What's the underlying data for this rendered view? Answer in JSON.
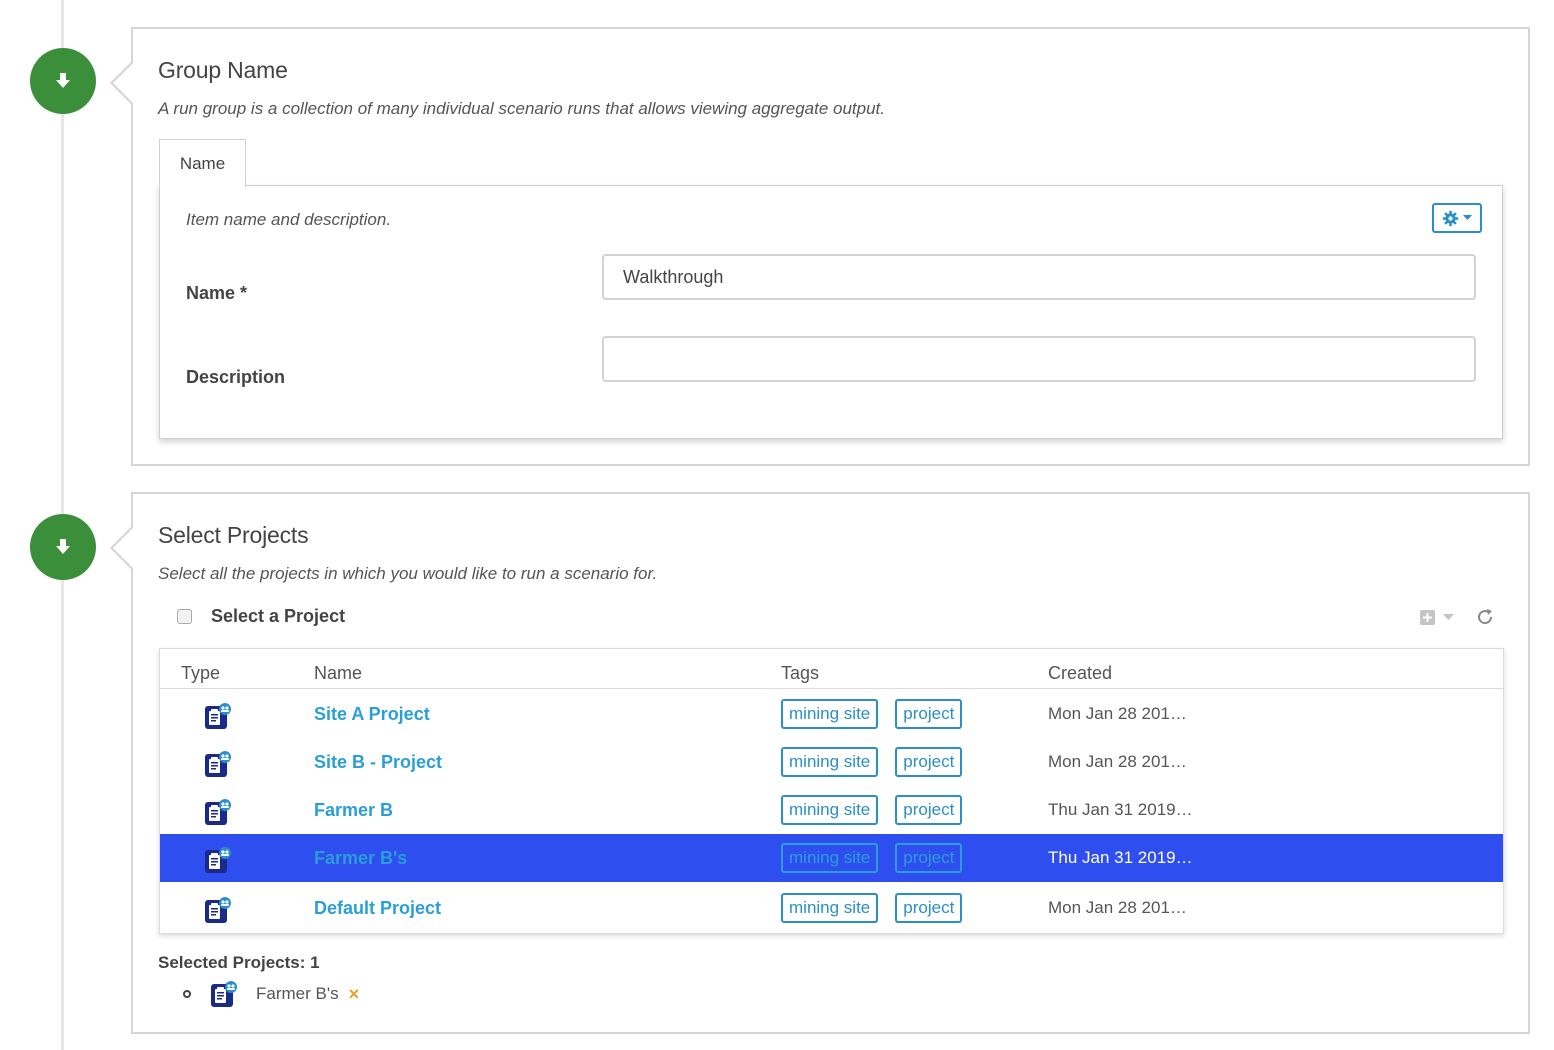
{
  "steps": [
    {
      "title": "Group Name",
      "description": "A run group is a collection of many individual scenario runs that allows viewing aggregate output.",
      "tabs": [
        {
          "label": "Name"
        }
      ],
      "tab_description": "Item name and description.",
      "fields": {
        "name": {
          "label": "Name *",
          "value": "Walkthrough"
        },
        "description": {
          "label": "Description",
          "value": ""
        }
      }
    },
    {
      "title": "Select Projects",
      "description": "Select all the projects in which you would like to run a scenario for.",
      "select_all_label": "Select a Project",
      "table": {
        "columns": [
          "Type",
          "Name",
          "Tags",
          "Created"
        ],
        "rows": [
          {
            "name": "Site A Project",
            "tags": [
              "mining site",
              "project"
            ],
            "created": "Mon Jan 28 201…",
            "selected": false
          },
          {
            "name": "Site B - Project",
            "tags": [
              "mining site",
              "project"
            ],
            "created": "Mon Jan 28 201…",
            "selected": false
          },
          {
            "name": "Farmer B",
            "tags": [
              "mining site",
              "project"
            ],
            "created": "Thu Jan 31 2019…",
            "selected": false
          },
          {
            "name": "Farmer B's",
            "tags": [
              "mining site",
              "project"
            ],
            "created": "Thu Jan 31 2019…",
            "selected": true
          },
          {
            "name": "Default Project",
            "tags": [
              "mining site",
              "project"
            ],
            "created": "Mon Jan 28 201…",
            "selected": false
          }
        ]
      },
      "selected_label": "Selected Projects: 1",
      "selected_items": [
        {
          "name": "Farmer B's"
        }
      ],
      "remove_glyph": "×"
    }
  ],
  "icons": {
    "step": "download-arrow-icon",
    "settings": "gear-icon",
    "add": "plus-square-icon",
    "refresh": "refresh-icon",
    "project_type": "project-clipboard-icon"
  },
  "colors": {
    "accent": "#2a8fc9",
    "link": "#2a9fd6",
    "step_green": "#3b8f3b",
    "row_selected": "#2f4ef0",
    "remove": "#e8a030"
  }
}
